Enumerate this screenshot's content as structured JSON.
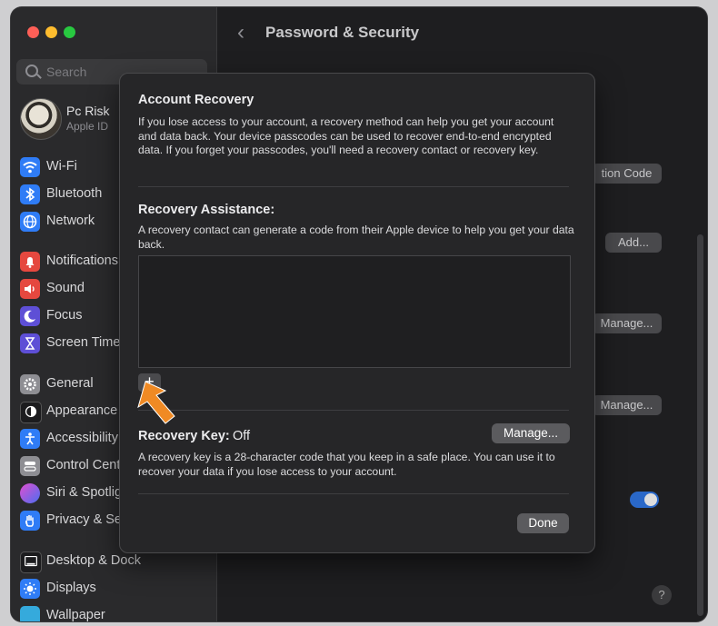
{
  "window": {
    "traffic_lights": {
      "close": "#fe5f57",
      "minimize": "#febc2e",
      "zoom": "#28c840"
    }
  },
  "sidebar": {
    "search_placeholder": "Search",
    "profile": {
      "name": "Pc Risk",
      "subtitle": "Apple ID"
    },
    "items": [
      {
        "label": "Wi-Fi",
        "icon": "wifi-icon",
        "color": "#2f7cf6"
      },
      {
        "label": "Bluetooth",
        "icon": "bluetooth-icon",
        "color": "#2f7cf6"
      },
      {
        "label": "Network",
        "icon": "globe-icon",
        "color": "#2f7cf6"
      },
      {
        "label": "Notifications",
        "icon": "bell-icon",
        "color": "#e5483f"
      },
      {
        "label": "Sound",
        "icon": "speaker-icon",
        "color": "#e5483f"
      },
      {
        "label": "Focus",
        "icon": "moon-icon",
        "color": "#5e4fd6"
      },
      {
        "label": "Screen Time",
        "icon": "hourglass-icon",
        "color": "#5e4fd6"
      },
      {
        "label": "General",
        "icon": "gear-icon",
        "color": "#8e8e93"
      },
      {
        "label": "Appearance",
        "icon": "appearance-icon",
        "color": "#1c1c1e"
      },
      {
        "label": "Accessibility",
        "icon": "accessibility-icon",
        "color": "#2f7cf6"
      },
      {
        "label": "Control Centre",
        "icon": "control-centre-icon",
        "color": "#8e8e93"
      },
      {
        "label": "Siri & Spotlight",
        "icon": "siri-icon",
        "color": "#7a4fd6"
      },
      {
        "label": "Privacy & Security",
        "icon": "hand-icon",
        "color": "#2f7cf6"
      },
      {
        "label": "Desktop & Dock",
        "icon": "dock-icon",
        "color": "#1c1c1e"
      },
      {
        "label": "Displays",
        "icon": "sun-icon",
        "color": "#2f7cf6"
      },
      {
        "label": "Wallpaper",
        "icon": "wallpaper-icon",
        "color": "#35aadc"
      }
    ]
  },
  "main": {
    "title": "Password & Security",
    "bg_buttons": {
      "verification_code": "tion Code",
      "add": "Add...",
      "manage_1": "Manage...",
      "manage_2": "Manage..."
    },
    "help": "?"
  },
  "sheet": {
    "account_recovery_title": "Account Recovery",
    "account_recovery_text": "If you lose access to your account, a recovery method can help you get your account and data back. Your device passcodes can be used to recover end-to-end encrypted data. If you forget your passcodes, you'll need a recovery contact or recovery key.",
    "recovery_assistance_title": "Recovery Assistance:",
    "recovery_assistance_text": "A recovery contact can generate a code from their Apple device to help you get your data back.",
    "add_button": "+",
    "recovery_key_label": "Recovery Key:",
    "recovery_key_status": "Off",
    "manage_button": "Manage...",
    "recovery_key_text": "A recovery key is a 28-character code that you keep in a safe place. You can use it to recover your data if you lose access to your account.",
    "done_button": "Done"
  },
  "annotation": {
    "arrow_color": "#f08a24"
  }
}
